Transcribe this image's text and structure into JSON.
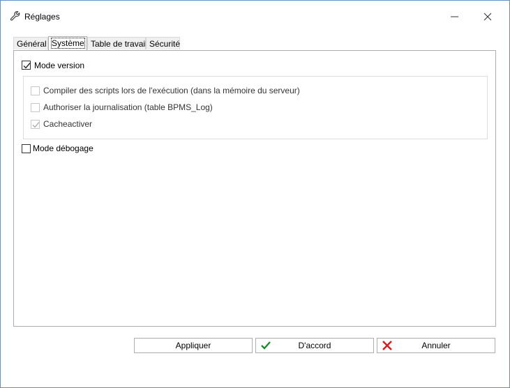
{
  "window": {
    "title": "Réglages",
    "icon": "wrench-icon"
  },
  "titlebar": {
    "minimize_icon": "minimize-icon",
    "close_icon": "close-icon"
  },
  "tabs": [
    {
      "label": "Général",
      "active": false
    },
    {
      "label": "Système",
      "active": true
    },
    {
      "label": "Table de travail",
      "active": false
    },
    {
      "label": "Sécurité",
      "active": false
    }
  ],
  "system": {
    "mode_version": {
      "label": "Mode version",
      "checked": true
    },
    "sub_options": [
      {
        "label": "Compiler des scripts lors de l'exécution (dans la mémoire du serveur)",
        "checked": false,
        "enabled": false
      },
      {
        "label": "Authoriser la journalisation (table BPMS_Log)",
        "checked": false,
        "enabled": false
      },
      {
        "label": "Cacheactiver",
        "checked": true,
        "enabled": false
      }
    ],
    "debug_mode": {
      "label": "Mode débogage",
      "checked": false
    }
  },
  "buttons": {
    "apply": "Appliquer",
    "ok": "D'accord",
    "cancel": "Annuler"
  },
  "colors": {
    "ok_icon": "#1a8a2e",
    "cancel_icon": "#d42020",
    "window_border": "#5f90c8"
  }
}
